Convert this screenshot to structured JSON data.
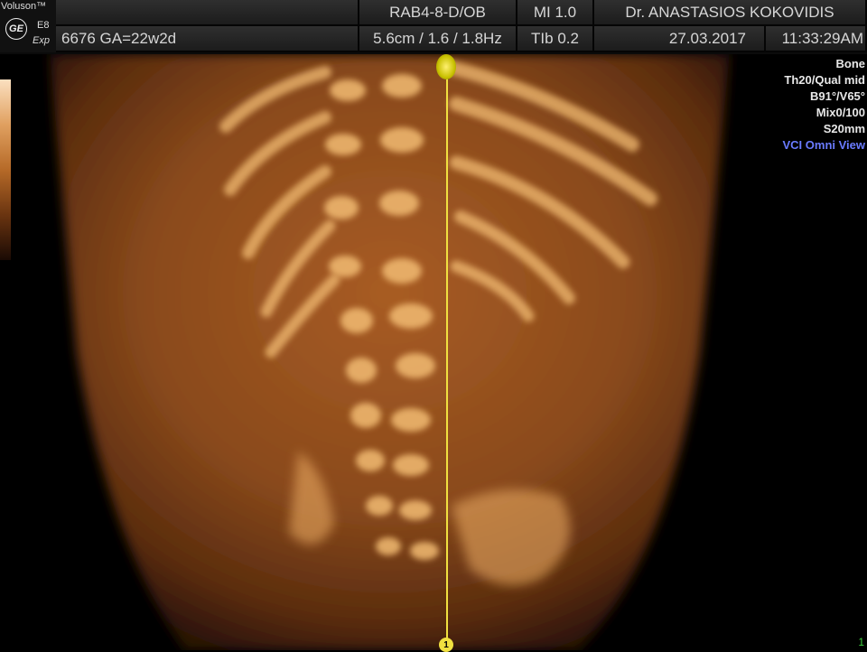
{
  "logo": {
    "brand": "Voluson™",
    "model": "E8",
    "edition": "Exp",
    "ge_mark": "GE"
  },
  "header": {
    "probe": "RAB4-8-D/OB",
    "mi": "MI  1.0",
    "operator": "Dr. ANASTASIOS KOKOVIDIS",
    "patient": "6676  GA=22w2d",
    "depth_freq": "5.6cm / 1.6 / 1.8Hz",
    "tib": "TIb  0.2",
    "date": "27.03.2017",
    "time": "11:33:29AM"
  },
  "right_panel": {
    "mode": "Bone",
    "threshold_quality": "Th20/Qual mid",
    "angles": "B91°/V65°",
    "mix": "Mix0/100",
    "slice": "S20mm",
    "view": "VCI Omni View"
  },
  "markers": {
    "bottom_label": "1",
    "corner_label": "1"
  },
  "colors": {
    "tissue": "#8a4a1c",
    "bone": "#f4c078",
    "cursor": "#f0e040",
    "vci_text": "#6a7bff"
  }
}
